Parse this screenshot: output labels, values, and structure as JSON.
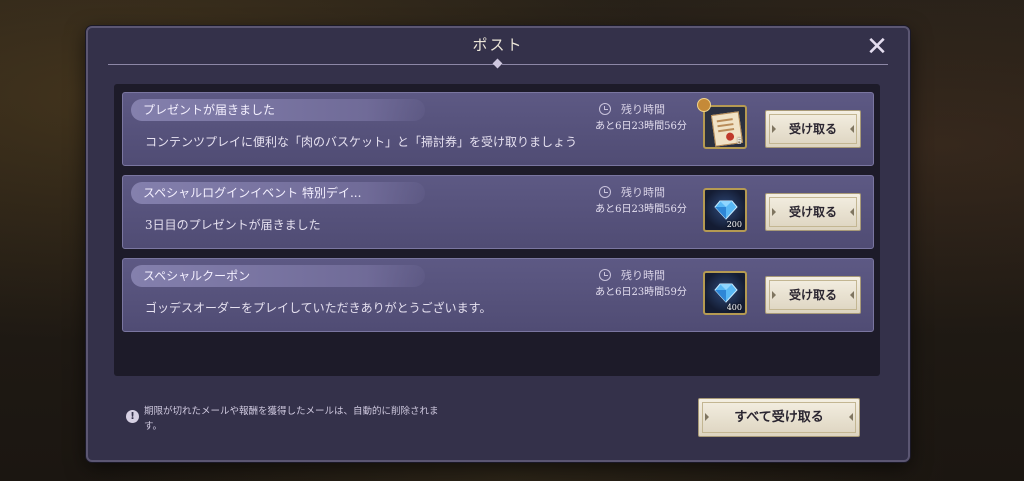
{
  "window": {
    "title": "ポスト",
    "close_icon": "close-icon"
  },
  "items": [
    {
      "title": "プレゼントが届きました",
      "message": "コンテンツプレイに便利な「肉のバスケット」と「掃討券」を受け取りましょう",
      "remain_label": "残り時間",
      "remain_time": "あと6日23時間56分",
      "reward_icon": "ticket-icon",
      "reward_count": "5",
      "claim_label": "受け取る"
    },
    {
      "title": "スペシャルログインイベント 特別デイ...",
      "message": "3日目のプレゼントが届きました",
      "remain_label": "残り時間",
      "remain_time": "あと6日23時間56分",
      "reward_icon": "gem-icon",
      "reward_count": "200",
      "claim_label": "受け取る"
    },
    {
      "title": "スペシャルクーポン",
      "message": "ゴッデスオーダーをプレイしていただきありがとうございます。",
      "remain_label": "残り時間",
      "remain_time": "あと6日23時間59分",
      "reward_icon": "gem-icon",
      "reward_count": "400",
      "claim_label": "受け取る"
    }
  ],
  "footer": {
    "notice": "期限が切れたメールや報酬を獲得したメールは、自動的に削除されます。",
    "claim_all_label": "すべて受け取る"
  },
  "colors": {
    "panel": "#34314a",
    "item": "#5d5984",
    "button": "#f4efe2",
    "reward_border": "#b59a52"
  }
}
